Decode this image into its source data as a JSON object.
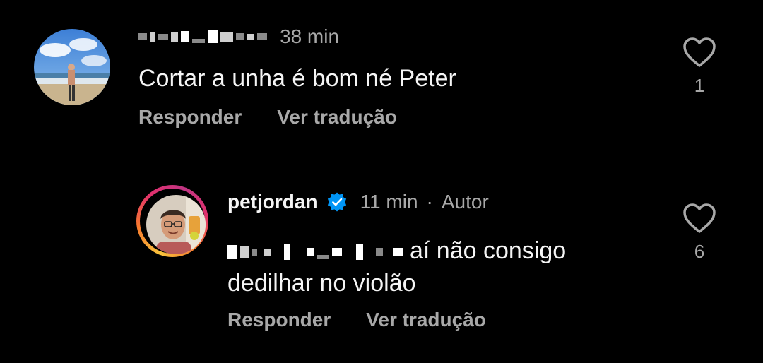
{
  "comments": [
    {
      "time": "38 min",
      "text": "Cortar a unha é bom né Peter",
      "reply_label": "Responder",
      "translate_label": "Ver tradução",
      "like_count": "1"
    },
    {
      "username": "petjordan",
      "verified": true,
      "time": "11 min",
      "separator": "·",
      "author_tag": "Autor",
      "text_line1": "aí não consigo",
      "text_line2": "dedilhar no violão",
      "reply_label": "Responder",
      "translate_label": "Ver tradução",
      "like_count": "6"
    }
  ],
  "icons": {
    "heart": "heart-icon",
    "verified": "verified-badge-icon"
  },
  "colors": {
    "background": "#000000",
    "primary_text": "#f5f5f5",
    "secondary_text": "#a8a8a8",
    "verified_blue": "#0095f6"
  }
}
